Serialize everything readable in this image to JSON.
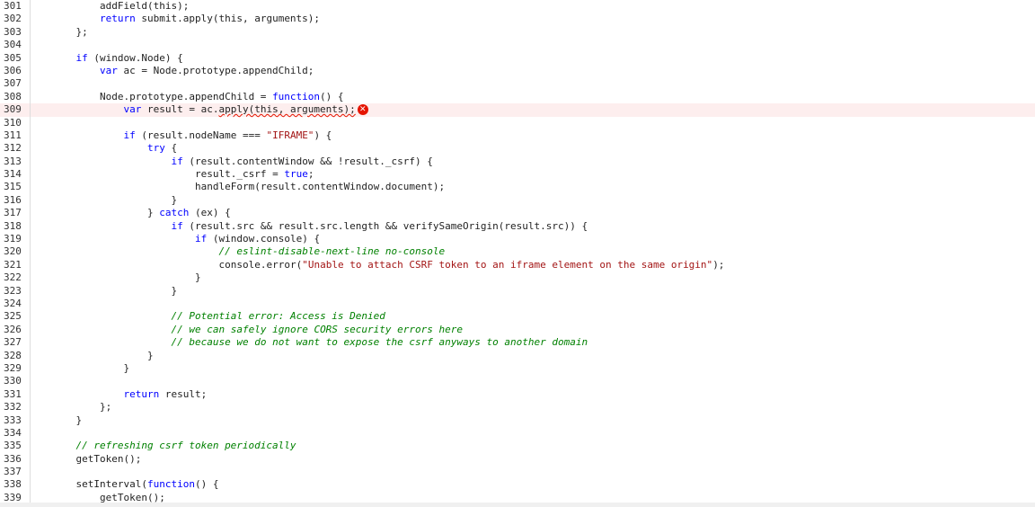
{
  "editor": {
    "lines": [
      {
        "n": "301",
        "indent": 2,
        "segments": [
          {
            "t": "addField(this);"
          }
        ]
      },
      {
        "n": "302",
        "indent": 2,
        "segments": [
          {
            "t": "return",
            "c": "kw"
          },
          {
            "t": " submit.apply(this, arguments);"
          }
        ]
      },
      {
        "n": "303",
        "indent": 1,
        "segments": [
          {
            "t": "};"
          }
        ]
      },
      {
        "n": "304",
        "indent": 0,
        "segments": []
      },
      {
        "n": "305",
        "indent": 1,
        "segments": [
          {
            "t": "if",
            "c": "kw"
          },
          {
            "t": " (window.Node) {"
          }
        ]
      },
      {
        "n": "306",
        "indent": 2,
        "segments": [
          {
            "t": "var",
            "c": "kw"
          },
          {
            "t": " ac = Node.prototype.appendChild;"
          }
        ]
      },
      {
        "n": "307",
        "indent": 0,
        "segments": []
      },
      {
        "n": "308",
        "indent": 2,
        "segments": [
          {
            "t": "Node.prototype.appendChild = "
          },
          {
            "t": "function",
            "c": "kw"
          },
          {
            "t": "() {"
          }
        ]
      },
      {
        "n": "309",
        "indent": 3,
        "error": true,
        "segments": [
          {
            "t": "var",
            "c": "kw"
          },
          {
            "t": " result = ac."
          },
          {
            "t": "apply(this, arguments);",
            "c": "squiggle"
          }
        ]
      },
      {
        "n": "310",
        "indent": 0,
        "segments": []
      },
      {
        "n": "311",
        "indent": 3,
        "segments": [
          {
            "t": "if",
            "c": "kw"
          },
          {
            "t": " (result.nodeName === "
          },
          {
            "t": "\"IFRAME\"",
            "c": "str"
          },
          {
            "t": ") {"
          }
        ]
      },
      {
        "n": "312",
        "indent": 4,
        "segments": [
          {
            "t": "try",
            "c": "kw"
          },
          {
            "t": " {"
          }
        ]
      },
      {
        "n": "313",
        "indent": 5,
        "segments": [
          {
            "t": "if",
            "c": "kw"
          },
          {
            "t": " (result.contentWindow && !result._csrf) {"
          }
        ]
      },
      {
        "n": "314",
        "indent": 6,
        "segments": [
          {
            "t": "result._csrf = "
          },
          {
            "t": "true",
            "c": "kw"
          },
          {
            "t": ";"
          }
        ]
      },
      {
        "n": "315",
        "indent": 6,
        "segments": [
          {
            "t": "handleForm(result.contentWindow.document);"
          }
        ]
      },
      {
        "n": "316",
        "indent": 5,
        "segments": [
          {
            "t": "}"
          }
        ]
      },
      {
        "n": "317",
        "indent": 4,
        "segments": [
          {
            "t": "} "
          },
          {
            "t": "catch",
            "c": "kw"
          },
          {
            "t": " (ex) {"
          }
        ]
      },
      {
        "n": "318",
        "indent": 5,
        "segments": [
          {
            "t": "if",
            "c": "kw"
          },
          {
            "t": " (result.src && result.src.length && verifySameOrigin(result.src)) {"
          }
        ]
      },
      {
        "n": "319",
        "indent": 6,
        "segments": [
          {
            "t": "if",
            "c": "kw"
          },
          {
            "t": " (window.console) {"
          }
        ]
      },
      {
        "n": "320",
        "indent": 7,
        "segments": [
          {
            "t": "// eslint-disable-next-line no-console",
            "c": "com"
          }
        ]
      },
      {
        "n": "321",
        "indent": 7,
        "segments": [
          {
            "t": "console.error("
          },
          {
            "t": "\"Unable to attach CSRF token to an iframe element on the same origin\"",
            "c": "str"
          },
          {
            "t": ");"
          }
        ]
      },
      {
        "n": "322",
        "indent": 6,
        "segments": [
          {
            "t": "}"
          }
        ]
      },
      {
        "n": "323",
        "indent": 5,
        "segments": [
          {
            "t": "}"
          }
        ]
      },
      {
        "n": "324",
        "indent": 0,
        "segments": []
      },
      {
        "n": "325",
        "indent": 5,
        "segments": [
          {
            "t": "// Potential error: Access is Denied",
            "c": "com"
          }
        ]
      },
      {
        "n": "326",
        "indent": 5,
        "segments": [
          {
            "t": "// we can safely ignore CORS security errors here",
            "c": "com"
          }
        ]
      },
      {
        "n": "327",
        "indent": 5,
        "segments": [
          {
            "t": "// because we do not want to expose the csrf anyways to another domain",
            "c": "com"
          }
        ]
      },
      {
        "n": "328",
        "indent": 4,
        "segments": [
          {
            "t": "}"
          }
        ]
      },
      {
        "n": "329",
        "indent": 3,
        "segments": [
          {
            "t": "}"
          }
        ]
      },
      {
        "n": "330",
        "indent": 0,
        "segments": []
      },
      {
        "n": "331",
        "indent": 3,
        "segments": [
          {
            "t": "return",
            "c": "kw"
          },
          {
            "t": " result;"
          }
        ]
      },
      {
        "n": "332",
        "indent": 2,
        "segments": [
          {
            "t": "};"
          }
        ]
      },
      {
        "n": "333",
        "indent": 1,
        "segments": [
          {
            "t": "}"
          }
        ]
      },
      {
        "n": "334",
        "indent": 0,
        "segments": []
      },
      {
        "n": "335",
        "indent": 1,
        "segments": [
          {
            "t": "// refreshing csrf token periodically",
            "c": "com"
          }
        ]
      },
      {
        "n": "336",
        "indent": 1,
        "segments": [
          {
            "t": "getToken();"
          }
        ]
      },
      {
        "n": "337",
        "indent": 0,
        "segments": []
      },
      {
        "n": "338",
        "indent": 1,
        "segments": [
          {
            "t": "setInterval("
          },
          {
            "t": "function",
            "c": "kw"
          },
          {
            "t": "() {"
          }
        ]
      },
      {
        "n": "339",
        "indent": 2,
        "segments": [
          {
            "t": "getToken();"
          }
        ]
      }
    ],
    "error_icon": "error-icon",
    "error_color": "#e51400"
  }
}
